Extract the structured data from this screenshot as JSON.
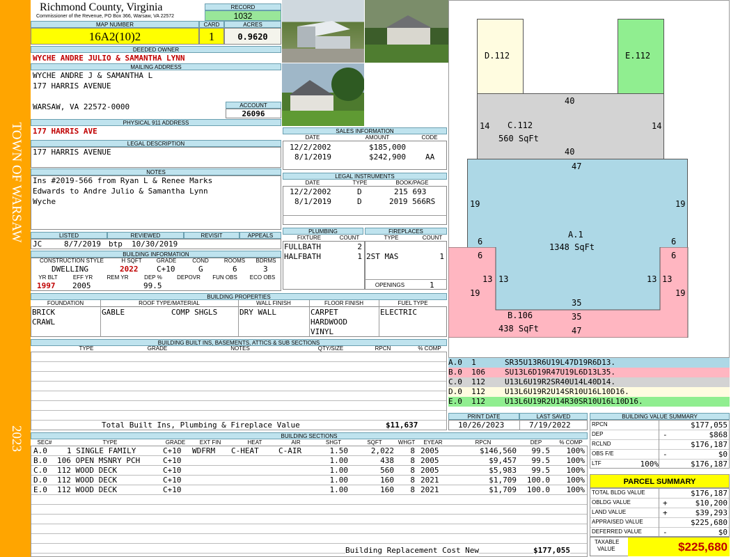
{
  "sidebar": {
    "town": "TOWN OF WARSAW",
    "year": "2023"
  },
  "header": {
    "county": "Richmond County, Virginia",
    "commissioner": "Commissioner of the Revenue, PO Box 366, Warsaw, VA 22572",
    "record_label": "RECORD",
    "record": "1032",
    "map_number_label": "MAP NUMBER",
    "map_number": "16A2(10)2",
    "card_label": "CARD",
    "card": "1",
    "acres_label": "ACRES",
    "acres": "0.9620"
  },
  "owner": {
    "deeded_label": "DEEDED OWNER",
    "deeded": "WYCHE ANDRE JULIO & SAMANTHA LYNN",
    "mailing_label": "MAILING ADDRESS",
    "mailing_1": "WYCHE ANDRE J & SAMANTHA L",
    "mailing_2": "177 HARRIS AVENUE",
    "mailing_3": "WARSAW, VA 22572-0000",
    "account_label": "ACCOUNT",
    "account": "26096",
    "p911_label": "PHYSICAL 911 ADDRESS",
    "p911": "177 HARRIS AVE",
    "legal_label": "LEGAL DESCRIPTION",
    "legal": "177 HARRIS AVENUE",
    "notes_label": "NOTES",
    "notes_1": "Ins #2019-566 from Ryan L & Renee Marks",
    "notes_2": "Edwards to Andre Julio & Samantha Lynn",
    "notes_3": "Wyche"
  },
  "sales": {
    "label": "SALES INFORMATION",
    "cols": [
      "DATE",
      "AMOUNT",
      "CODE"
    ],
    "rows": [
      {
        "date": "12/2/2002",
        "amount": "$185,000",
        "code": ""
      },
      {
        "date": "8/1/2019",
        "amount": "$242,900",
        "code": "AA"
      }
    ]
  },
  "legal_instruments": {
    "label": "LEGAL INSTRUMENTS",
    "cols": [
      "DATE",
      "TYPE",
      "BOOK/PAGE"
    ],
    "rows": [
      {
        "date": "12/2/2002",
        "type": "D",
        "book": "215 693"
      },
      {
        "date": "8/1/2019",
        "type": "D",
        "book": "2019 566RS"
      }
    ]
  },
  "plumbing": {
    "label": "PLUMBING",
    "cols": [
      "FIXTURE",
      "COUNT"
    ],
    "rows": [
      {
        "fixture": "FULLBATH",
        "count": "2"
      },
      {
        "fixture": "HALFBATH",
        "count": "1"
      }
    ]
  },
  "fireplaces": {
    "label": "FIREPLACES",
    "cols": [
      "TYPE",
      "COUNT"
    ],
    "rows": [
      {
        "type": "2ST MAS",
        "count": "1"
      }
    ],
    "openings_label": "OPENINGS",
    "openings": "1"
  },
  "review": {
    "cols": [
      "LISTED",
      "REVIEWED",
      "REVISIT",
      "APPEALS"
    ],
    "listed_by": "JC",
    "listed": "8/7/2019",
    "reviewed_by": "btp",
    "reviewed": "10/30/2019"
  },
  "building_info": {
    "label": "BUILDING INFORMATION",
    "cols1": [
      "CONSTRUCTION STYLE",
      "H SQFT",
      "GRADE",
      "COND",
      "ROOMS",
      "BDRMS"
    ],
    "style": "DWELLING",
    "hsqft": "2022",
    "grade": "C+10",
    "cond": "G",
    "rooms": "6",
    "bdrms": "3",
    "cols2": [
      "YR BLT",
      "EFF YR",
      "REM YR",
      "DEP %",
      "DEPOVR",
      "FUN OBS",
      "ECO OBS"
    ],
    "yrblt": "1997",
    "effyr": "2005",
    "dep": "99.5"
  },
  "properties": {
    "label": "BUILDING PROPERTIES",
    "cols": [
      "FOUNDATION",
      "ROOF TYPE/MATERIAL",
      "WALL FINISH",
      "FLOOR FINISH",
      "FUEL TYPE"
    ],
    "foundation_1": "BRICK",
    "foundation_2": "CRAWL",
    "roof_type": "GABLE",
    "roof_material": "COMP SHGLS",
    "wall": "DRY WALL",
    "floor_1": "CARPET",
    "floor_2": "HARDWOOD",
    "floor_3": "VINYL",
    "fuel": "ELECTRIC"
  },
  "built_ins": {
    "label": "BUILDING BUILT INS, BASEMENTS, ATTICS & SUB SECTIONS",
    "cols": [
      "TYPE",
      "GRADE",
      "NOTES",
      "QTY/SIZE",
      "RPCN",
      "% COMP"
    ],
    "total_label": "Total Built Ins, Plumbing & Fireplace Value",
    "total": "$11,637"
  },
  "sketch": {
    "D": {
      "label": "D.112"
    },
    "E": {
      "label": "E.112"
    },
    "C": {
      "label": "C.112",
      "area": "560 SqFt",
      "top": "40",
      "bottom": "40",
      "left": "14",
      "right": "14"
    },
    "A": {
      "label": "A.1",
      "area": "1348 SqFt",
      "top": "47",
      "left": "19",
      "right": "19",
      "lstep": "6",
      "rstep": "6",
      "linner": "13",
      "rinner": "13"
    },
    "B": {
      "label": "B.106",
      "area": "438 SqFt",
      "top": "35",
      "mid": "35",
      "bottom": "47",
      "lstep": "6",
      "rstep": "6",
      "l13": "13",
      "r13": "13",
      "l19": "19",
      "r19": "19"
    },
    "codes": [
      {
        "sec": "A.0",
        "n": "1",
        "code": "SR35U13R6U19L47D19R6D13.",
        "color": "#add8e6"
      },
      {
        "sec": "B.0",
        "n": "106",
        "code": "SU13L6D19R47U19L6D13L35.",
        "color": "#ffb6c1"
      },
      {
        "sec": "C.0",
        "n": "112",
        "code": "U13L6U19R2SR40U14L40D14.",
        "color": "#d3d3d3"
      },
      {
        "sec": "D.0",
        "n": "112",
        "code": "U13L6U19R2U14SR10U16L10D16.",
        "color": "#fffce0"
      },
      {
        "sec": "E.0",
        "n": "112",
        "code": "U13L6U19R2U14R30SR10U16L10D16.",
        "color": "#90ee90"
      }
    ]
  },
  "dates": {
    "print_label": "PRINT DATE",
    "print": "10/26/2023",
    "saved_label": "LAST SAVED",
    "saved": "7/19/2022"
  },
  "bvs": {
    "label": "BUILDING VALUE SUMMARY",
    "rows": [
      {
        "k": "RPCN",
        "s": "",
        "v": "$177,055"
      },
      {
        "k": "DEP",
        "s": "-",
        "v": "$868"
      },
      {
        "k": "RCLND",
        "s": "",
        "v": "$176,187"
      },
      {
        "k": "OBS F/E",
        "s": "-",
        "v": "$0"
      },
      {
        "k": "LTF",
        "s": "100%",
        "v": "$176,187"
      }
    ]
  },
  "parcel": {
    "label": "PARCEL SUMMARY",
    "rows": [
      {
        "k": "TOTAL BLDG VALUE",
        "s": "",
        "v": "$176,187"
      },
      {
        "k": "OBLDG VALUE",
        "s": "+",
        "v": "$10,200"
      },
      {
        "k": "LAND VALUE",
        "s": "+",
        "v": "$39,293"
      },
      {
        "k": "APPRAISED VALUE",
        "s": "",
        "v": "$225,680"
      },
      {
        "k": "DEFERRED VALUE",
        "s": "-",
        "v": "$0"
      }
    ],
    "taxable_1": "TAXABLE",
    "taxable_2": "VALUE",
    "taxable": "$225,680"
  },
  "sections": {
    "label": "BUILDING SECTIONS",
    "cols": [
      "SEC#",
      "TYPE",
      "GRADE",
      "EXT FIN",
      "HEAT",
      "AIR",
      "SHGT",
      "SQFT",
      "WHGT",
      "EYEAR",
      "RPCN",
      "DEP",
      "% COMP"
    ],
    "rows": [
      {
        "sec": "A.0",
        "type": "1 SINGLE FAMILY",
        "grade": "C+10",
        "ext": "WDFRM",
        "heat": "C-HEAT",
        "air": "C-AIR",
        "shgt": "1.50",
        "sqft": "2,022",
        "whgt": "8",
        "eyear": "2005",
        "rpcn": "$146,560",
        "dep": "99.5",
        "comp": "100%"
      },
      {
        "sec": "B.0",
        "type": "106 OPEN MSNRY PCH",
        "grade": "C+10",
        "ext": "",
        "heat": "",
        "air": "",
        "shgt": "1.00",
        "sqft": "438",
        "whgt": "8",
        "eyear": "2005",
        "rpcn": "$9,457",
        "dep": "99.5",
        "comp": "100%"
      },
      {
        "sec": "C.0",
        "type": "112 WOOD DECK",
        "grade": "C+10",
        "ext": "",
        "heat": "",
        "air": "",
        "shgt": "1.00",
        "sqft": "560",
        "whgt": "8",
        "eyear": "2005",
        "rpcn": "$5,983",
        "dep": "99.5",
        "comp": "100%"
      },
      {
        "sec": "D.0",
        "type": "112 WOOD DECK",
        "grade": "C+10",
        "ext": "",
        "heat": "",
        "air": "",
        "shgt": "1.00",
        "sqft": "160",
        "whgt": "8",
        "eyear": "2021",
        "rpcn": "$1,709",
        "dep": "100.0",
        "comp": "100%"
      },
      {
        "sec": "E.0",
        "type": "112 WOOD DECK",
        "grade": "C+10",
        "ext": "",
        "heat": "",
        "air": "",
        "shgt": "1.00",
        "sqft": "160",
        "whgt": "8",
        "eyear": "2021",
        "rpcn": "$1,709",
        "dep": "100.0",
        "comp": "100%"
      }
    ],
    "replacement_label": "Building Replacement Cost New",
    "replacement": "$177,055"
  }
}
